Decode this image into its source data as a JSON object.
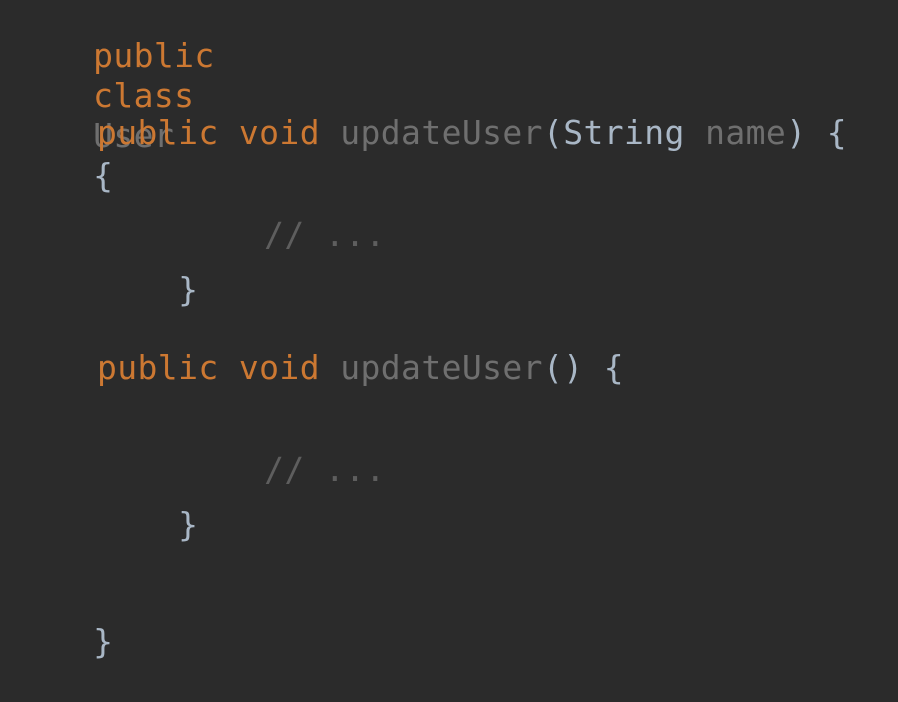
{
  "code": {
    "class_decl": {
      "kw1": "public",
      "kw2": "class",
      "name": "User",
      "brace": "{"
    },
    "method1": {
      "kw1": "public",
      "kw2": "void",
      "name": "updateUser",
      "open_paren": "(",
      "param_type": "String",
      "param_name": "name",
      "close": ") {",
      "comment": "// ...",
      "end_brace": "}"
    },
    "method2": {
      "kw1": "public",
      "kw2": "void",
      "name": "updateUser",
      "parens": "() {",
      "comment": "// ...",
      "end_brace": "}"
    },
    "class_end": "}"
  },
  "colors": {
    "background": "#2b2b2b",
    "keyword": "#cc7832",
    "identifier": "#6f6f6f",
    "default_text": "#a9b7c6",
    "comment": "#5e5e5e"
  }
}
